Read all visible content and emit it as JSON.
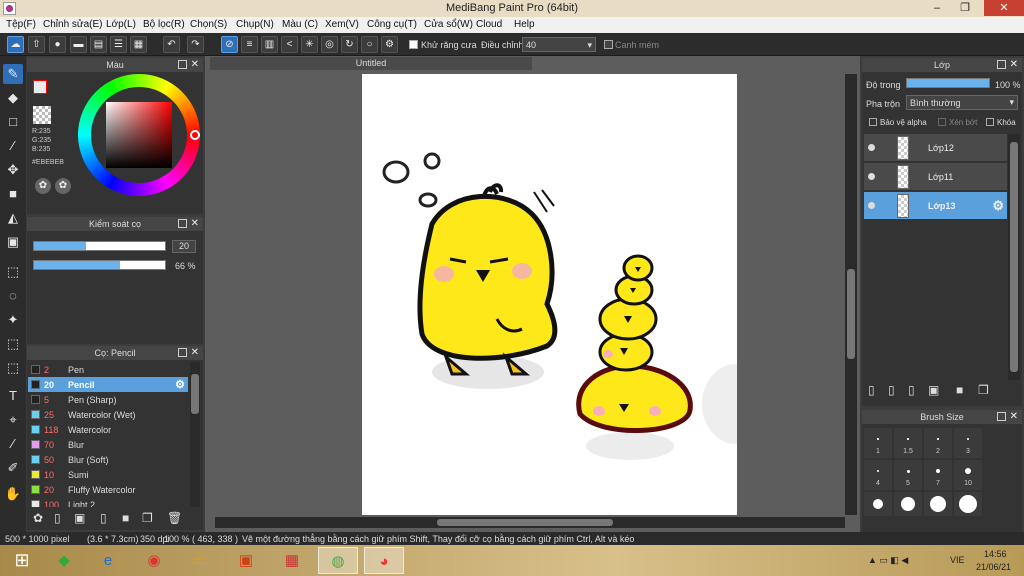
{
  "window": {
    "title": "MediBang Paint Pro (64bit)",
    "minimize": "–",
    "maximize": "❐",
    "close": "✕"
  },
  "menu": [
    "Tệp(F)",
    "Chỉnh sửa(E)",
    "Lớp(L)",
    "Bộ lọc(R)",
    "Chọn(S)",
    "Chụp(N)",
    "Màu (C)",
    "Xem(V)",
    "Công cụ(T)",
    "Cửa sổ(W)",
    "Cloud",
    "Help"
  ],
  "toolbar": {
    "antialias_label": "Khử răng cưa",
    "adjust_label": "Điều chỉnh",
    "adjust_value": "40",
    "edge_label": "Canh mém"
  },
  "color_panel": {
    "title": "Màu",
    "r": "R:235",
    "g": "G:235",
    "b": "B:235",
    "hex": "#EBEBEB",
    "current_color": "#ebebeb"
  },
  "brush_control": {
    "title": "Kiểm soát cọ",
    "size_value": "20",
    "opacity_value": "66 %",
    "opacity": 0.66,
    "size_fraction": 0.4
  },
  "brush_panel": {
    "title": "Cọ: Pencil",
    "items": [
      {
        "size": "2",
        "name": "Pen",
        "color": "#222222"
      },
      {
        "size": "20",
        "name": "Pencil",
        "color": "#222222",
        "selected": true
      },
      {
        "size": "5",
        "name": "Pen (Sharp)",
        "color": "#222222"
      },
      {
        "size": "25",
        "name": "Watercolor (Wet)",
        "color": "#6ad0f0"
      },
      {
        "size": "118",
        "name": "Watercolor",
        "color": "#6ad0f0"
      },
      {
        "size": "70",
        "name": "Blur",
        "color": "#e89af0"
      },
      {
        "size": "50",
        "name": "Blur (Soft)",
        "color": "#6ad0f0"
      },
      {
        "size": "10",
        "name": "Sumi",
        "color": "#e8e840"
      },
      {
        "size": "20",
        "name": "Fluffy Watercolor",
        "color": "#8ae040"
      },
      {
        "size": "100",
        "name": "Light 2",
        "color": "#e8e8e8"
      }
    ]
  },
  "document": {
    "tab_title": "Untitled"
  },
  "layer_panel": {
    "title": "Lớp",
    "opacity_label": "Độ trong",
    "opacity_value": "100 %",
    "blend_label": "Pha trộn",
    "blend_value": "Bình thường",
    "protect_alpha": "Bảo vệ alpha",
    "clipping": "Xén bớt",
    "lock": "Khóa",
    "layers": [
      {
        "name": "Lớp12",
        "selected": false
      },
      {
        "name": "Lớp11",
        "selected": false
      },
      {
        "name": "Lớp13",
        "selected": true
      }
    ]
  },
  "brush_size_panel": {
    "title": "Brush Size",
    "sizes": [
      "1",
      "1.5",
      "2",
      "3",
      "4",
      "5",
      "7",
      "10"
    ]
  },
  "statusbar": {
    "dimensions": "500 * 1000 pixel",
    "physical": "(3.6 * 7.3cm)",
    "dpi": "350 dpi",
    "zoom": "100 %",
    "coords": "( 463, 338 )",
    "hint": "Vẽ một đường thẳng bằng cách giữ phím Shift, Thay đổi cỡ cọ bằng cách giữ phím Ctrl, Alt và kéo"
  },
  "taskbar": {
    "language": "VIE",
    "time": "14:56",
    "date": "21/06/21"
  }
}
